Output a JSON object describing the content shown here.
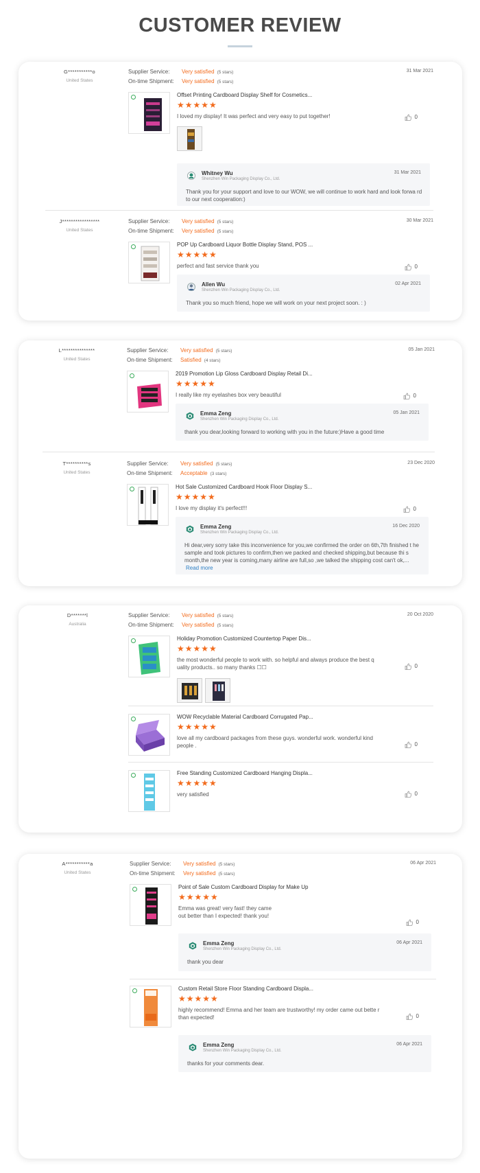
{
  "page": {
    "title": "CUSTOMER REVIEW"
  },
  "common": {
    "supplier_label": "Supplier Service:",
    "ontime_label": "On-time Shipment:",
    "company": "Shenzhen Win Packaging Display Co., Ltd."
  },
  "reviews": [
    {
      "user": "G***********o",
      "country": "United States",
      "date": "31 Mar 2021",
      "supplier": "Very satisfied",
      "supplier_stars": "(5 stars)",
      "shipment": "Very satisfied",
      "shipment_stars": "(5 stars)",
      "products": [
        {
          "title": "Offset Printing Cardboard Display Shelf for Cosmetics...",
          "stars": "★★★★★",
          "text": "I loved my display! It was perfect and very easy to put together!",
          "likes": "0"
        }
      ],
      "reply": {
        "name": "Whitney Wu",
        "date": "31 Mar 2021",
        "text": "Thank you for your support and love to our WOW, we will continue to work hard and look forwa rd to our next cooperation:)"
      }
    },
    {
      "user": "J*****************",
      "country": "United States",
      "date": "30 Mar 2021",
      "supplier": "Very satisfied",
      "supplier_stars": "(5 stars)",
      "shipment": "Very satisfied",
      "shipment_stars": "(5 stars)",
      "products": [
        {
          "title": "POP Up Cardboard Liquor Bottle Display Stand, POS ...",
          "stars": "★★★★★",
          "text": "perfect and fast service thank you",
          "likes": "0"
        }
      ],
      "reply": {
        "name": "Allen Wu",
        "date": "02 Apr 2021",
        "text": "Thank you so much friend, hope we will work on your next project soon. : )"
      }
    },
    {
      "user": "L***************",
      "country": "United States",
      "date": "05 Jan 2021",
      "supplier": "Very satisfied",
      "supplier_stars": "(5 stars)",
      "shipment": "Satisfied",
      "shipment_stars": "(4 stars)",
      "products": [
        {
          "title": "2019 Promotion Lip Gloss Cardboard Display Retail Di...",
          "stars": "★★★★★",
          "text": "I really like my eyelashes  box very beautiful",
          "likes": "0"
        }
      ],
      "reply": {
        "name": "Emma Zeng",
        "date": "05 Jan 2021",
        "text": "thank you dear,looking forward to working with you in the future:)Have a good time"
      }
    },
    {
      "user": "T**********s",
      "country": "United States",
      "date": "23 Dec 2020",
      "supplier": "Very satisfied",
      "supplier_stars": "(5 stars)",
      "shipment": "Acceptable",
      "shipment_stars": "(3 stars)",
      "products": [
        {
          "title": "Hot Sale Customized Cardboard Hook Floor Display S...",
          "stars": "★★★★★",
          "text": "I love my display it's perfect!!!",
          "likes": "0"
        }
      ],
      "reply": {
        "name": "Emma Zeng",
        "date": "16 Dec 2020",
        "text": "Hi dear,very sorry take this inconvenience  for you,we confirmed the order on 6th,7th finished t he sample and took pictures to confirm,then we packed and checked shipping,but because thi s month,the new year is coming,many airline are full,so ,we talked the shipping cost can't ok,...",
        "more": "Read more"
      }
    },
    {
      "user": "D*******l",
      "country": "Australia",
      "date": "20 Oct 2020",
      "supplier": "Very satisfied",
      "supplier_stars": "(5 stars)",
      "shipment": "Very satisfied",
      "shipment_stars": "(5 stars)",
      "products": [
        {
          "title": "Holiday Promotion Customized Countertop Paper Dis...",
          "stars": "★★★★★",
          "text": "the most wonderful people to work with. so helpful and always produce the best q uality products.. so many thanks ☐☐",
          "likes": "0"
        },
        {
          "title": "WOW Recyclable Material Cardboard Corrugated Pap...",
          "stars": "★★★★★",
          "text": "love all my cardboard packages from these guys. wonderful work. wonderful kind people .",
          "likes": "0"
        },
        {
          "title": "Free Standing Customized Cardboard Hanging Displa...",
          "stars": "★★★★★",
          "text": "very satisfied",
          "likes": "0"
        }
      ]
    },
    {
      "user": "A***********a",
      "country": "United States",
      "date": "06 Apr 2021",
      "supplier": "Very satisfied",
      "supplier_stars": "(5 stars)",
      "shipment": "Very satisfied",
      "shipment_stars": "(5 stars)",
      "products": [
        {
          "title": "Point of Sale Custom Cardboard Display for Make Up",
          "stars": "★★★★★",
          "text": "Emma was great! very fast! they came out better than I expected! thank you!",
          "likes": "0",
          "reply": {
            "name": "Emma Zeng",
            "date": "06 Apr 2021",
            "text": "thank you dear"
          }
        },
        {
          "title": "Custom Retail Store Floor Standing Cardboard Displa...",
          "stars": "★★★★★",
          "text": "highly recommend! Emma and her team are trustworthy! my order came out bette r than expected!",
          "likes": "0",
          "reply": {
            "name": "Emma Zeng",
            "date": "06 Apr 2021",
            "text": "thanks for your comments dear."
          }
        }
      ]
    }
  ],
  "colors": {
    "accent": "#f26b1d",
    "link": "#2d7fc4",
    "badge": "#3bab5b"
  }
}
